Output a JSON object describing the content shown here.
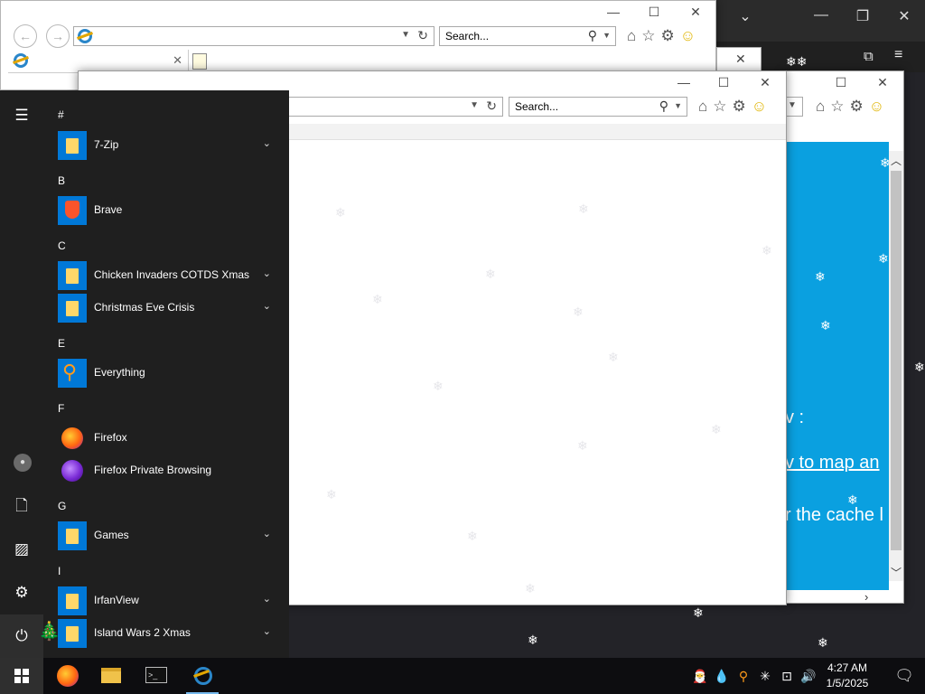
{
  "background_app": {
    "controls": [
      "⌄",
      "—",
      "❐",
      "✕"
    ],
    "extensions_icon": "puzzle-icon",
    "menu_icon": "hamburger-icon"
  },
  "ie_back": {
    "address_value": "",
    "search_placeholder": "Search...",
    "title_controls": [
      "—",
      "☐",
      "✕"
    ]
  },
  "ie_right": {
    "title_controls": [
      "☐",
      "✕"
    ],
    "content_lines": [
      "v :",
      "v to map an",
      "r the cache l"
    ]
  },
  "ie_front": {
    "address_value": "",
    "search_placeholder": "Search...",
    "title_controls": [
      "—",
      "☐",
      "✕"
    ]
  },
  "start_menu": {
    "groups": [
      {
        "letter": "#",
        "apps": [
          {
            "name": "7-Zip",
            "icon": "folder-icon",
            "expandable": true
          }
        ]
      },
      {
        "letter": "B",
        "apps": [
          {
            "name": "Brave",
            "icon": "brave-icon",
            "expandable": false
          }
        ]
      },
      {
        "letter": "C",
        "apps": [
          {
            "name": "Chicken Invaders COTDS Xmas",
            "icon": "folder-icon",
            "expandable": true
          },
          {
            "name": "Christmas Eve Crisis",
            "icon": "folder-icon",
            "expandable": true
          }
        ]
      },
      {
        "letter": "E",
        "apps": [
          {
            "name": "Everything",
            "icon": "everything-search-icon",
            "expandable": false
          }
        ]
      },
      {
        "letter": "F",
        "apps": [
          {
            "name": "Firefox",
            "icon": "firefox-icon",
            "expandable": false
          },
          {
            "name": "Firefox Private Browsing",
            "icon": "firefox-private-icon",
            "expandable": false
          }
        ]
      },
      {
        "letter": "G",
        "apps": [
          {
            "name": "Games",
            "icon": "folder-icon",
            "expandable": true
          }
        ]
      },
      {
        "letter": "I",
        "apps": [
          {
            "name": "IrfanView",
            "icon": "folder-icon",
            "expandable": true
          },
          {
            "name": "Island Wars 2 Xmas",
            "icon": "folder-icon",
            "expandable": true
          }
        ]
      }
    ]
  },
  "taskbar": {
    "clock_time": "4:27 AM",
    "clock_date": "1/5/2025",
    "pinned": [
      "firefox-icon",
      "file-explorer-icon",
      "command-prompt-icon",
      "internet-explorer-icon"
    ],
    "cmd_label": ">_"
  },
  "colors": {
    "accent_blue": "#0078d7",
    "page_blue": "#0aa0e0",
    "start_bg": "#1f1f1f"
  }
}
